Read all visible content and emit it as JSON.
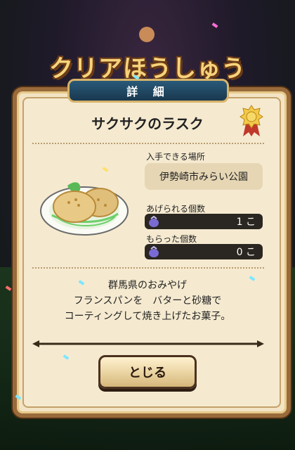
{
  "banner": {
    "title": "クリアほうしゅう"
  },
  "dialog": {
    "header": "詳 細",
    "item_name": "サクサクのラスク",
    "obtain_place_label": "入手できる場所",
    "obtain_place_value": "伊勢崎市みらい公園",
    "given_count_label": "あげられる個数",
    "given_count_value": "1 こ",
    "received_count_label": "もらった個数",
    "received_count_value": "0 こ",
    "description": {
      "line1": "群馬県のおみやげ",
      "line2": "フランスパンを　バターと砂糖で",
      "line3": "コーティングして焼き上げたお菓子。"
    },
    "close_button_label": "とじる"
  },
  "icons": {
    "medal": "medal-icon",
    "bag": "bag-icon",
    "food": "rusk-plate-image"
  },
  "colors": {
    "frame": "#9a6b3a",
    "panel": "#f5ead0",
    "header": "#19384e",
    "bar": "#2a2621"
  }
}
